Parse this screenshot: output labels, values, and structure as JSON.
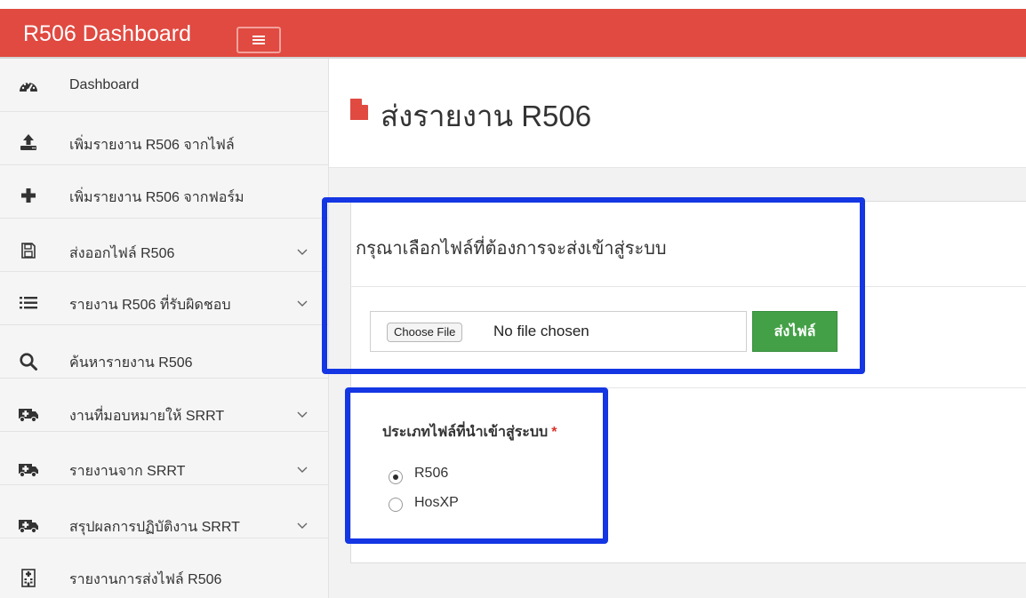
{
  "header": {
    "brand": "R506 Dashboard",
    "menu_toggle_icon": "hamburger-icon",
    "color": "#e04a41"
  },
  "sidebar": {
    "items": [
      {
        "label": "Dashboard",
        "icon": "dashboard-gauge-icon",
        "has_submenu": false
      },
      {
        "label": "เพิ่มรายงาน R506 จากไฟล์",
        "icon": "upload-icon",
        "has_submenu": false
      },
      {
        "label": "เพิ่มรายงาน R506 จากฟอร์ม",
        "icon": "plus-icon",
        "has_submenu": false
      },
      {
        "label": "ส่งออกไฟล์ R506",
        "icon": "save-floppy-icon",
        "has_submenu": true
      },
      {
        "label": "รายงาน R506 ที่รับผิดชอบ",
        "icon": "list-icon",
        "has_submenu": true
      },
      {
        "label": "ค้นหารายงาน R506",
        "icon": "search-icon",
        "has_submenu": false
      },
      {
        "label": "งานที่มอบหมายให้ SRRT",
        "icon": "ambulance-icon",
        "has_submenu": true
      },
      {
        "label": "รายงานจาก SRRT",
        "icon": "ambulance-icon",
        "has_submenu": true
      },
      {
        "label": "สรุปผลการปฏิบัติงาน SRRT",
        "icon": "ambulance-icon",
        "has_submenu": true
      },
      {
        "label": "รายงานการส่งไฟล์ R506",
        "icon": "hospital-building-icon",
        "has_submenu": false
      }
    ]
  },
  "page": {
    "title": "ส่งรายงาน R506",
    "title_icon": "file-icon",
    "title_icon_color": "#e04a41"
  },
  "upload": {
    "heading": "กรุณาเลือกไฟล์ที่ต้องการจะส่งเข้าสู่ระบบ",
    "choose_button": "Choose File",
    "file_status": "No file chosen",
    "send_button": "ส่งไฟล์",
    "send_button_color": "#43a047"
  },
  "file_type": {
    "label": "ประเภทไฟล์ที่นำเข้าสู่ระบบ",
    "required_mark": "*",
    "options": [
      {
        "label": "R506",
        "selected": true
      },
      {
        "label": "HosXP",
        "selected": false
      }
    ]
  },
  "annotation_color": "#1436e3"
}
